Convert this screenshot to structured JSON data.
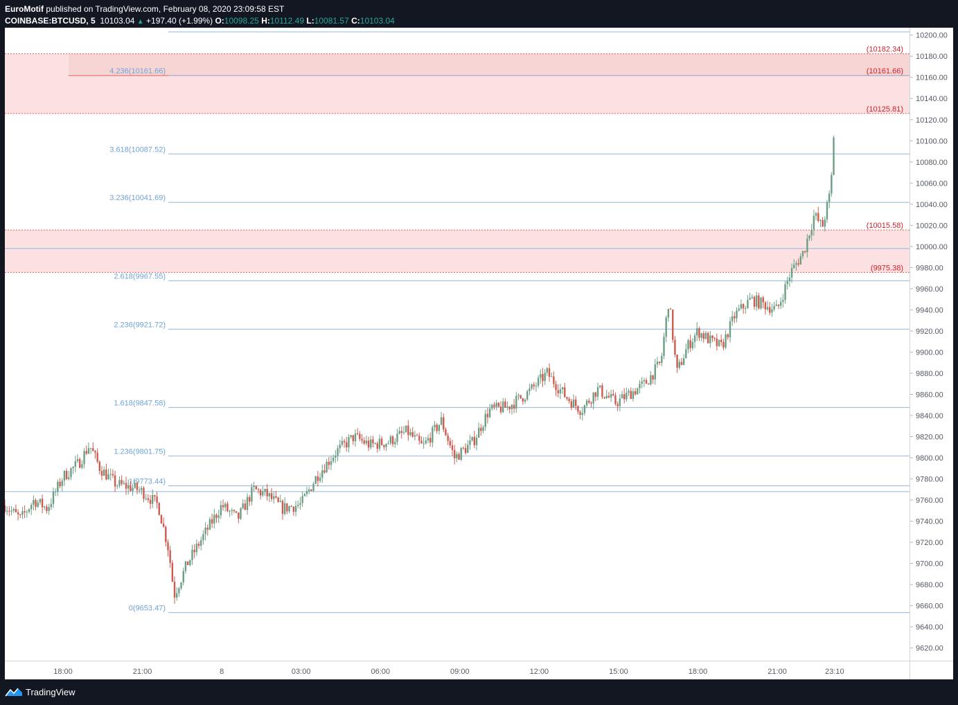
{
  "header": {
    "author": "EuroMotif",
    "published_text": "published on TradingView.com, February 08, 2020 23:09:58 EST",
    "symbol": "COINBASE:BTCUSD, 5",
    "last": "10103.04",
    "change": "+197.40 (+1.99%)",
    "o_label": "O:",
    "o": "10098.25",
    "h_label": "H:",
    "h": "10112.49",
    "l_label": "L:",
    "l": "10081.57",
    "c_label": "C:",
    "c": "10103.04"
  },
  "footer": {
    "brand": "TradingView",
    "icon": "tradingview-logo-icon"
  },
  "colors": {
    "up": "#6b9e84",
    "down": "#cd5a4c",
    "fib": "#8fb7de",
    "fib_text": "#6fa3d6",
    "zone_fill": "#fbe1e1",
    "zone_line": "#e55c5c",
    "zone_text": "#d11f26",
    "bg_dark": "#131722"
  },
  "chart_data": {
    "type": "candlestick",
    "title": "",
    "xlabel": "",
    "ylabel": "",
    "ylim": [
      9608,
      10207
    ],
    "y_ticks": [
      9620,
      9640,
      9660,
      9680,
      9700,
      9720,
      9740,
      9760,
      9780,
      9800,
      9820,
      9840,
      9860,
      9880,
      9900,
      9920,
      9940,
      9960,
      9980,
      10000,
      10020,
      10040,
      10060,
      10080,
      10100,
      10120,
      10140,
      10160,
      10180,
      10200
    ],
    "y_tick_labels": [
      "9620.00",
      "9640.00",
      "9660.00",
      "9680.00",
      "9700.00",
      "9720.00",
      "9740.00",
      "9760.00",
      "9780.00",
      "9800.00",
      "9820.00",
      "9840.00",
      "9860.00",
      "9880.00",
      "9900.00",
      "9920.00",
      "9940.00",
      "9960.00",
      "9980.00",
      "10000.00",
      "10020.00",
      "10040.00",
      "10060.00",
      "10080.00",
      "10100.00",
      "10120.00",
      "10140.00",
      "10160.00",
      "10180.00",
      "10200.00"
    ],
    "x_ticks": [
      "18:00",
      "21:00",
      "8",
      "03:00",
      "06:00",
      "09:00",
      "12:00",
      "15:00",
      "18:00",
      "21:00",
      "23:10"
    ],
    "x_tick_hours": [
      -6,
      -3,
      0,
      3,
      6,
      9,
      12,
      15,
      18,
      21,
      23.1667
    ],
    "x_range_hours": [
      -8.2,
      26.0
    ],
    "grid": false,
    "fib_levels": [
      {
        "label": "0(9653.47)",
        "value": 9653.47
      },
      {
        "label": "1(9773.44)",
        "value": 9773.44
      },
      {
        "label": "1.236(9801.75)",
        "value": 9801.75
      },
      {
        "label": "1.618(9847.58)",
        "value": 9847.58
      },
      {
        "label": "2.236(9921.72)",
        "value": 9921.72
      },
      {
        "label": "2.618(9967.55)",
        "value": 9967.55
      },
      {
        "label": "3.236(10041.69)",
        "value": 10041.69
      },
      {
        "label": "3.618(10087.52)",
        "value": 10087.52
      },
      {
        "label": "4.236(10161.66)",
        "value": 10161.66
      }
    ],
    "fib_extra_lines": [
      9768,
      9998
    ],
    "zones": [
      {
        "top": 10182.34,
        "bottom": 10125.81,
        "top_label": "(10182.34)",
        "bottom_label": "(10125.81)",
        "inner_value": 10161.66,
        "inner_label": "(10161.66)"
      },
      {
        "top": 10015.58,
        "bottom": 9975.38,
        "top_label": "(10015.58)",
        "bottom_label": "(9975.38)"
      }
    ],
    "price_path": [
      [
        -8.2,
        9755
      ],
      [
        -7.6,
        9742
      ],
      [
        -7.1,
        9760
      ],
      [
        -6.6,
        9752
      ],
      [
        -6.0,
        9782
      ],
      [
        -5.4,
        9795
      ],
      [
        -5.0,
        9812
      ],
      [
        -4.6,
        9790
      ],
      [
        -4.0,
        9775
      ],
      [
        -3.4,
        9772
      ],
      [
        -3.0,
        9768
      ],
      [
        -2.4,
        9755
      ],
      [
        -2.0,
        9712
      ],
      [
        -1.8,
        9670
      ],
      [
        -1.3,
        9700
      ],
      [
        -0.6,
        9730
      ],
      [
        0.0,
        9755
      ],
      [
        0.6,
        9742
      ],
      [
        1.2,
        9770
      ],
      [
        1.7,
        9765
      ],
      [
        2.3,
        9752
      ],
      [
        3.0,
        9756
      ],
      [
        3.6,
        9783
      ],
      [
        4.3,
        9805
      ],
      [
        5.0,
        9820
      ],
      [
        5.6,
        9812
      ],
      [
        6.3,
        9815
      ],
      [
        7.0,
        9825
      ],
      [
        7.6,
        9810
      ],
      [
        8.3,
        9835
      ],
      [
        8.8,
        9800
      ],
      [
        9.5,
        9815
      ],
      [
        10.1,
        9845
      ],
      [
        10.8,
        9848
      ],
      [
        11.6,
        9862
      ],
      [
        12.3,
        9880
      ],
      [
        13.0,
        9858
      ],
      [
        13.6,
        9845
      ],
      [
        14.2,
        9865
      ],
      [
        14.9,
        9852
      ],
      [
        15.5,
        9862
      ],
      [
        16.0,
        9870
      ],
      [
        16.6,
        9890
      ],
      [
        16.9,
        9950
      ],
      [
        17.2,
        9880
      ],
      [
        17.6,
        9905
      ],
      [
        18.0,
        9920
      ],
      [
        18.5,
        9910
      ],
      [
        18.9,
        9905
      ],
      [
        19.4,
        9935
      ],
      [
        20.0,
        9950
      ],
      [
        20.5,
        9945
      ],
      [
        21.0,
        9940
      ],
      [
        21.5,
        9975
      ],
      [
        22.0,
        9995
      ],
      [
        22.4,
        10030
      ],
      [
        22.7,
        10018
      ],
      [
        23.0,
        10050
      ],
      [
        23.17,
        10103
      ]
    ],
    "last_close": 10103.04
  }
}
